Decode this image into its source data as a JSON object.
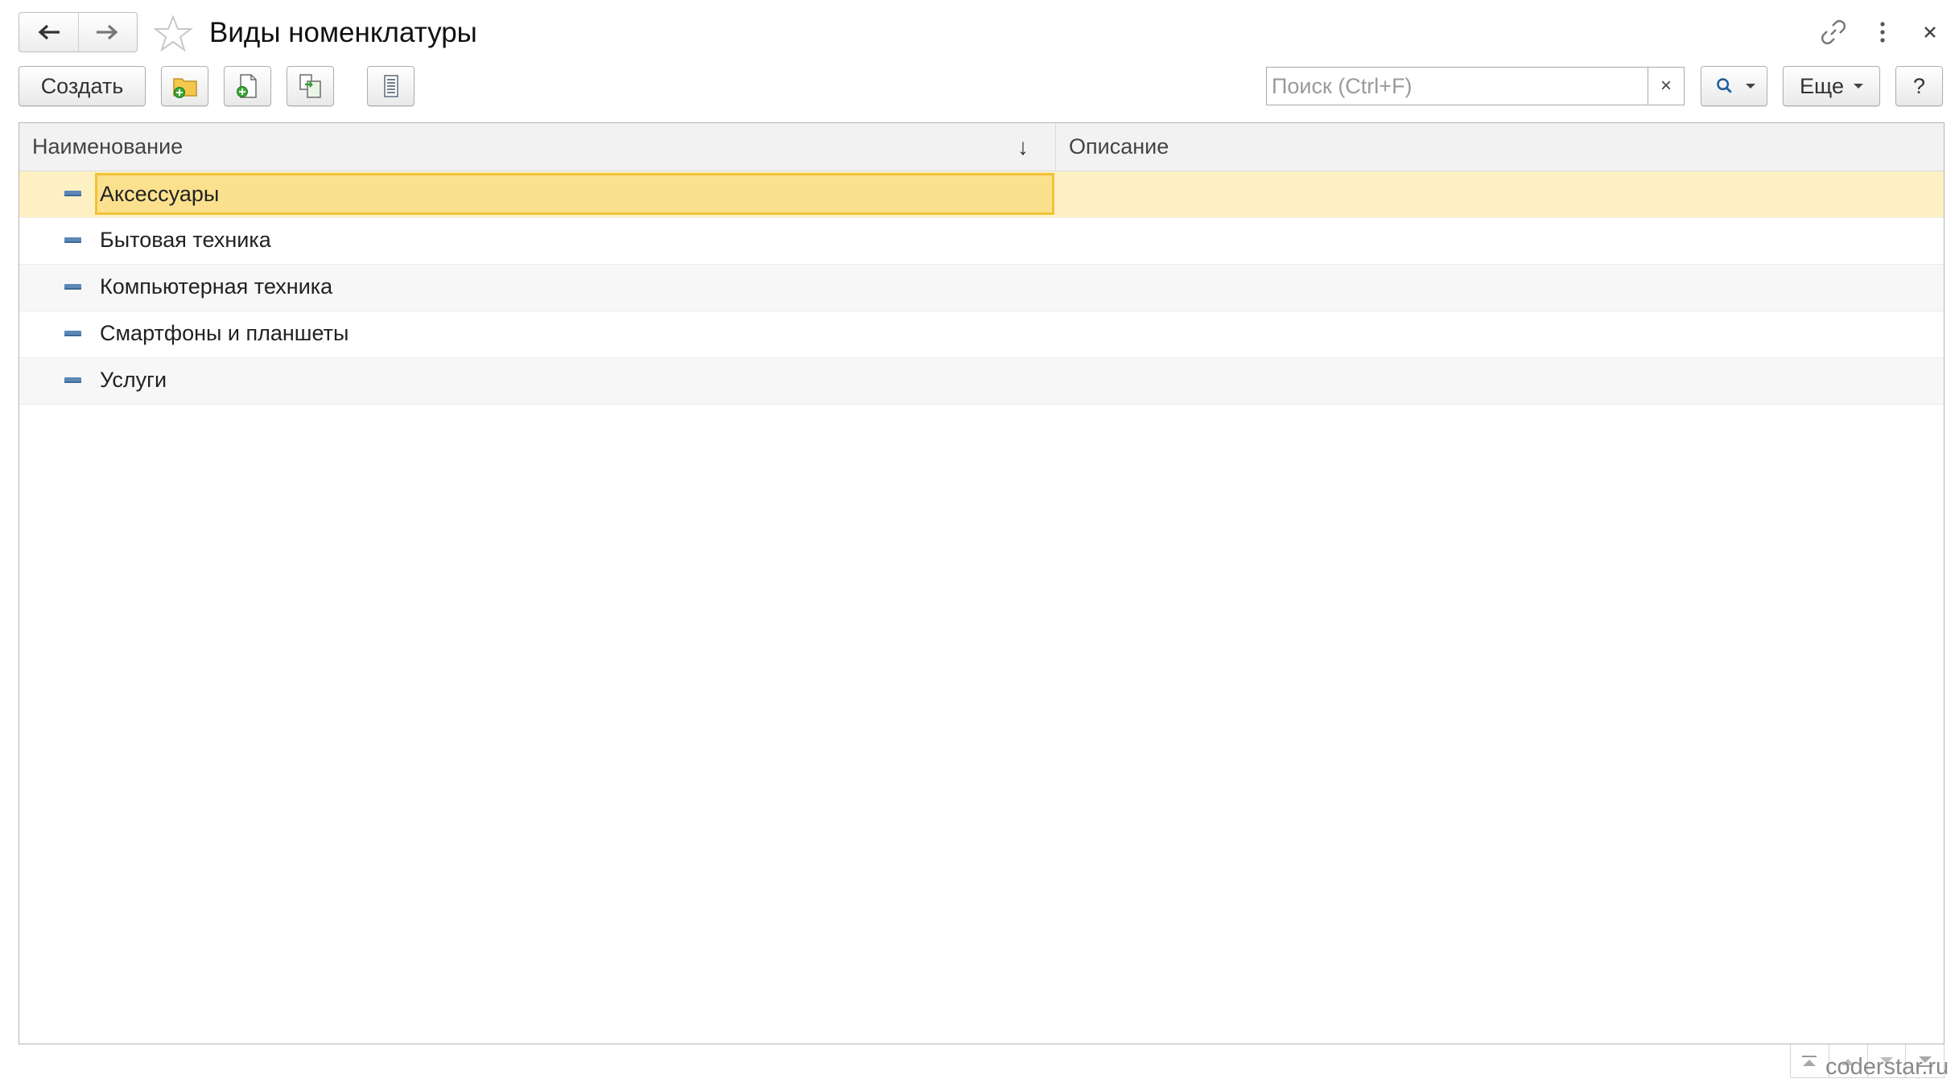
{
  "window": {
    "title": "Виды номенклатуры"
  },
  "toolbar": {
    "create_label": "Создать",
    "more_label": "Еще",
    "help_label": "?",
    "search_placeholder": "Поиск (Ctrl+F)",
    "search_clear": "×"
  },
  "table": {
    "columns": [
      "Наименование",
      "Описание"
    ],
    "sort_indicator": "↓",
    "rows": [
      {
        "name": "Аксессуары",
        "description": ""
      },
      {
        "name": "Бытовая техника",
        "description": ""
      },
      {
        "name": "Компьютерная техника",
        "description": ""
      },
      {
        "name": "Смартфоны и планшеты",
        "description": ""
      },
      {
        "name": "Услуги",
        "description": ""
      }
    ]
  },
  "watermark": "coderstar.ru",
  "colors": {
    "selection_fill": "#fbe18e",
    "selection_border": "#f2c237",
    "selected_row": "#fdf1c4",
    "row_icon": "#5b88b6"
  }
}
